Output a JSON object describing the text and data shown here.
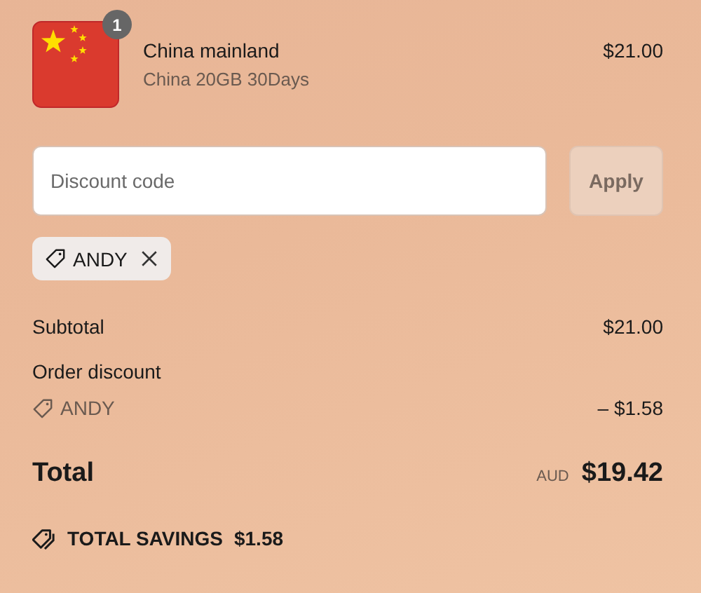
{
  "line_items": [
    {
      "quantity": "1",
      "title": "China mainland",
      "variant": "China 20GB 30Days",
      "price": "$21.00"
    }
  ],
  "discount": {
    "placeholder": "Discount code",
    "apply_button": {
      "label": "Apply",
      "disabled": true
    }
  },
  "applied_codes": [
    {
      "code": "ANDY"
    }
  ],
  "summary": {
    "subtotal": {
      "label": "Subtotal",
      "value": "$21.00"
    },
    "order_discount": {
      "label": "Order discount",
      "code": "ANDY",
      "value": "– $1.58"
    },
    "total": {
      "label": "Total",
      "currency": "AUD",
      "value": "$19.42"
    },
    "savings": {
      "label": "TOTAL SAVINGS",
      "value": "$1.58"
    }
  }
}
